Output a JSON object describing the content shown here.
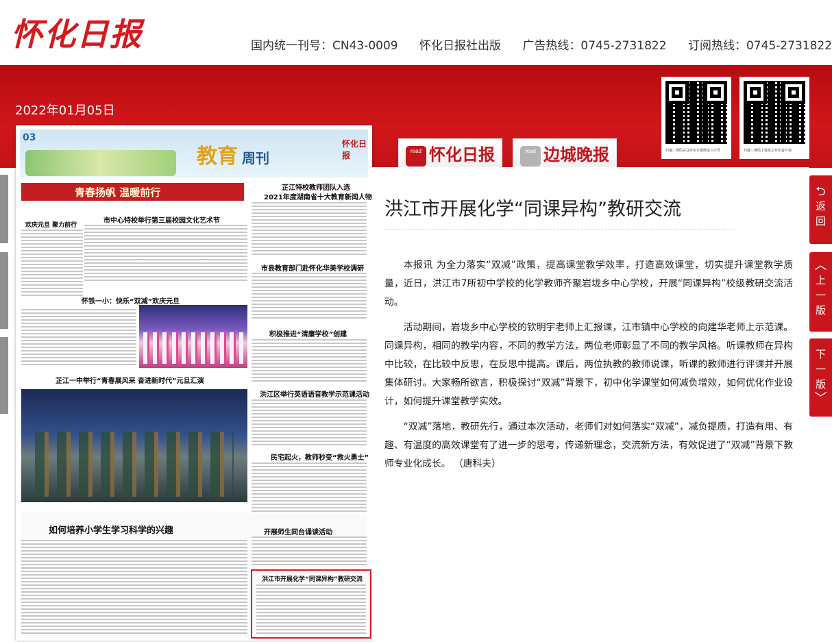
{
  "header": {
    "logo": "怀化日报",
    "meta": [
      "国内统一刊号：CN43-0009",
      "怀化日报社出版",
      "广告热线：0745-2731822",
      "订阅热线：0745-2731822"
    ],
    "date": "2022年01月05日"
  },
  "qr_codes": [
    {
      "caption": "扫描二维码关注怀化日报微信公众号"
    },
    {
      "caption": "扫描二维码下载掌上怀化客户端"
    }
  ],
  "tabs": [
    {
      "icon_text": "read",
      "label": "怀化日报",
      "active": true
    },
    {
      "icon_text": "read",
      "label": "边城晚报",
      "active": false
    }
  ],
  "newspaper": {
    "page_number": "03",
    "section_title": "教育",
    "section_suffix": "周刊",
    "masthead": "怀化日报",
    "banner": "青春扬帆 温暖前行",
    "headlines": [
      "芷江特校教师团队入选",
      "2021年度湖南省十大教育新闻人物",
      "市中心特校举行第三届校园文化艺术节",
      "欢庆元旦 聚力前行",
      "市县教育部门赴怀化华美学校调研",
      "怀铁一小：快乐“双减”欢庆元旦",
      "积极推进“清廉学校”创建",
      "芷江一中举行“青春展风采 奋进新时代”元旦汇演",
      "洪江区举行英语语音教学示范课活动",
      "民宅起火，教师秒变“救火勇士”",
      "如何培养小学生学习科学的兴趣",
      "开展师生同台诵读活动",
      "洪江市开展化学“同课异构”教研交流"
    ]
  },
  "article": {
    "title": "洪江市开展化学“同课异构”教研交流",
    "paragraphs": [
      "本报讯 为全力落实“双减”政策，提高课堂教学效率，打造高效课堂，切实提升课堂教学质量，近日，洪江市7所初中学校的化学教师齐聚岩垅乡中心学校，开展“同课异构”校级教研交流活动。",
      "活动期间，岩垅乡中心学校的钦明宇老师上汇报课，江市镇中心学校的向建华老师上示范课。同课异构，相同的教学内容，不同的教学方法，两位老师彰显了不同的教学风格。听课教师在异构中比较，在比较中反思，在反思中提高。课后，两位执教的教师说课，听课的教师进行评课并开展集体研讨。大家畅所欲言，积极探讨“双减”背景下，初中化学课堂如何减负增效，如何优化作业设计，如何提升课堂教学实效。",
      "“双减”落地，教研先行，通过本次活动，老师们对如何落实“双减”，减负提质，打造有用、有趣、有温度的高效课堂有了进一步的思考，传递新理念，交流新方法，有效促进了“双减”背景下教师专业化成长。 （唐科夫）"
    ]
  },
  "side_nav": [
    {
      "icon": "return-icon",
      "glyph": "⮌",
      "label": "返回"
    },
    {
      "icon": "chevron-up-icon",
      "glyph": "︿",
      "label": "上一版"
    },
    {
      "icon": "chevron-down-icon",
      "glyph": "﹀",
      "label": "下一版"
    }
  ],
  "colors": {
    "brand_red": "#c8161c",
    "highlight": "#e3161c"
  }
}
